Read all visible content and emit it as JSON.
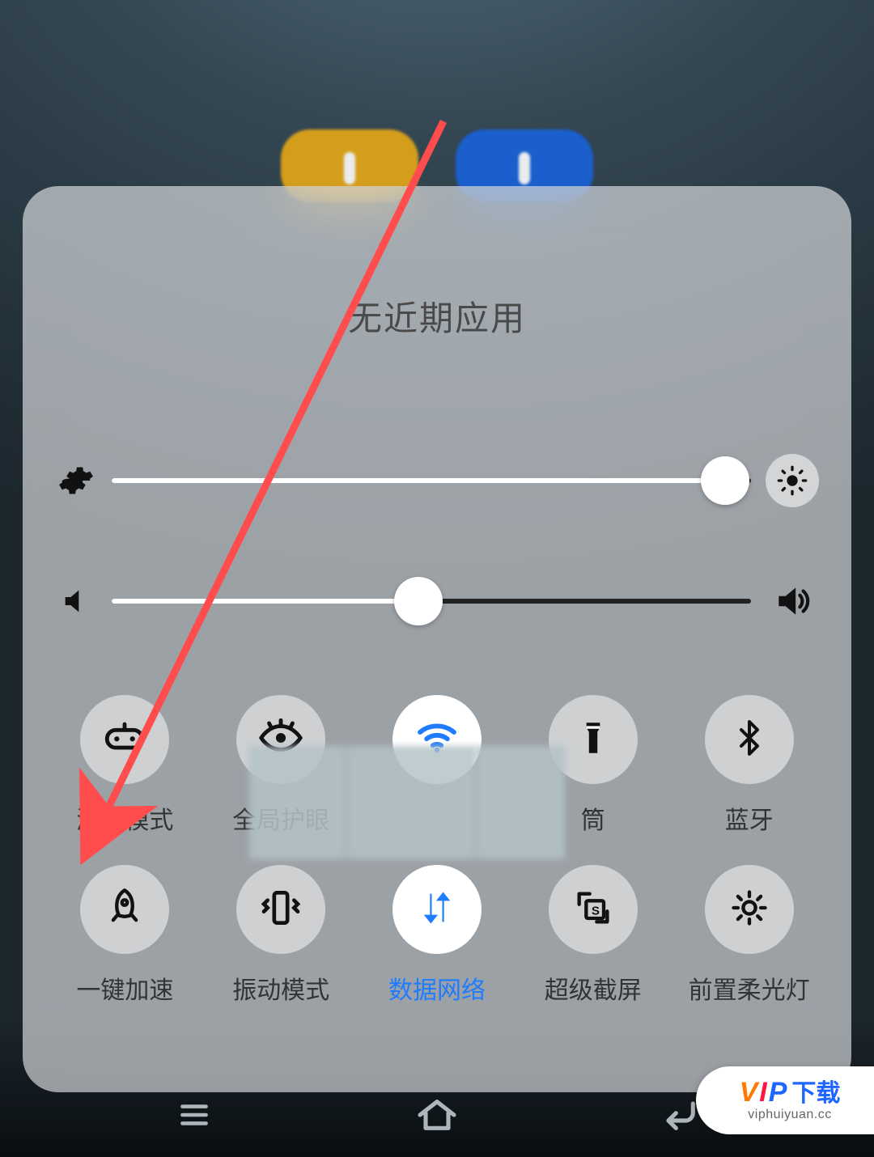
{
  "header": {
    "title": "无近期应用"
  },
  "sliders": {
    "brightness": {
      "left_icon": "gear-icon",
      "right_icon": "brightness-icon",
      "value_percent": 96
    },
    "volume": {
      "left_icon": "volume-mute-icon",
      "right_icon": "volume-up-icon",
      "value_percent": 48
    }
  },
  "toggles": {
    "row1": [
      {
        "id": "game-mode",
        "label": "游戏模式",
        "icon": "gamepad-icon",
        "active": false
      },
      {
        "id": "eye-protect",
        "label": "全局护眼",
        "icon": "eye-icon",
        "active": false,
        "label_obscured_suffix": true
      },
      {
        "id": "wifi",
        "label": "",
        "icon": "wifi-icon",
        "active": true,
        "label_obscured": true
      },
      {
        "id": "flashlight",
        "label": "筒",
        "icon": "flashlight-icon",
        "active": false,
        "label_obscured_prefix": true
      },
      {
        "id": "bluetooth",
        "label": "蓝牙",
        "icon": "bluetooth-icon",
        "active": false
      }
    ],
    "row2": [
      {
        "id": "boost",
        "label": "一键加速",
        "icon": "rocket-icon",
        "active": false
      },
      {
        "id": "vibrate",
        "label": "振动模式",
        "icon": "vibrate-icon",
        "active": false
      },
      {
        "id": "mobile-data",
        "label": "数据网络",
        "icon": "data-arrows-icon",
        "active": true
      },
      {
        "id": "screenshot",
        "label": "超级截屏",
        "icon": "super-screenshot-icon",
        "active": false
      },
      {
        "id": "front-light",
        "label": "前置柔光灯",
        "icon": "front-light-icon",
        "active": false
      }
    ]
  },
  "navbar": {
    "menu": "menu-icon",
    "home": "home-icon",
    "back": "back-icon"
  },
  "watermark": {
    "brand_parts": {
      "v": "V",
      "i": "I",
      "p": "P",
      "dl": "下载"
    },
    "url": "viphuiyuan.cc"
  },
  "annotation": {
    "arrow_color": "#ff4d4d"
  }
}
